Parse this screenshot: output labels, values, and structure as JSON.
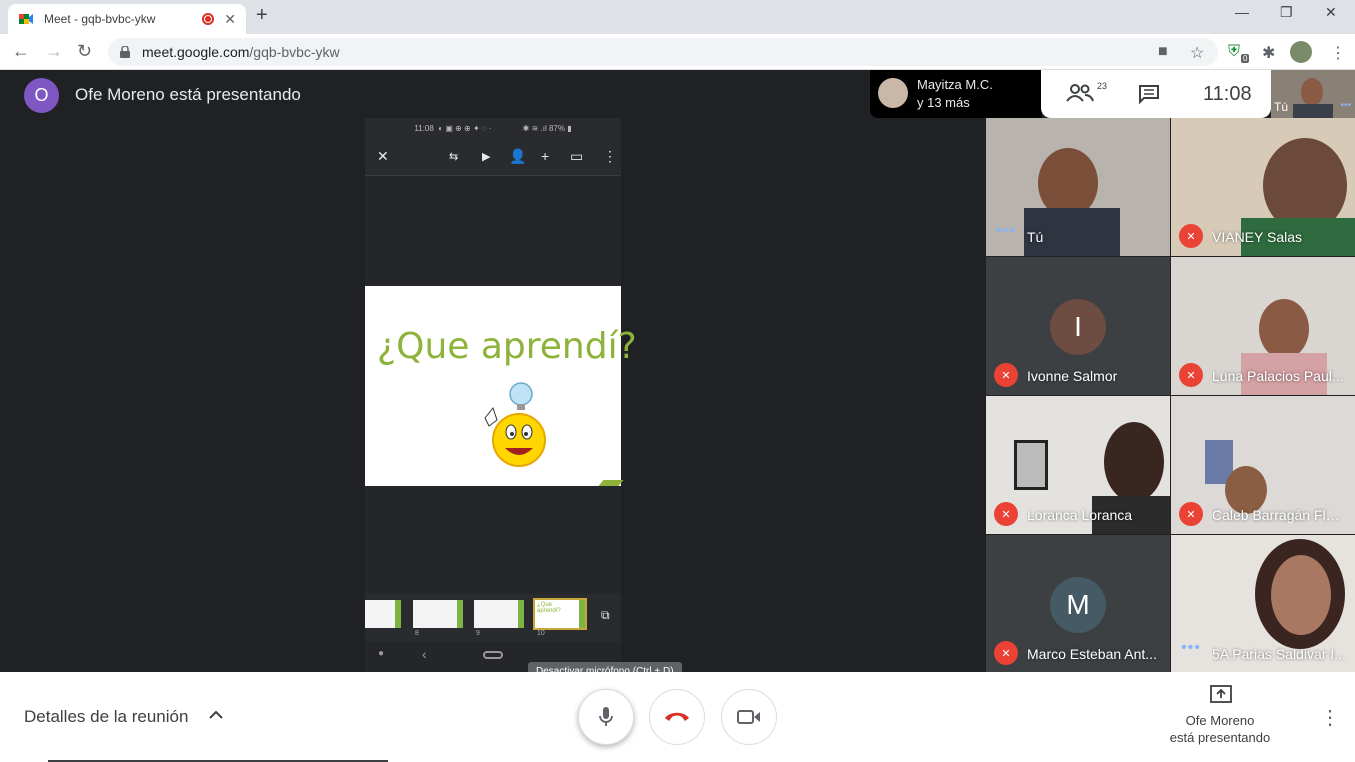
{
  "browser": {
    "tab_title": "Meet - gqb-bvbc-ykw",
    "url_host": "meet.google.com",
    "url_path": "/gqb-bvbc-ykw",
    "ext_badge": "0"
  },
  "meet": {
    "presenter_initial": "O",
    "presenter_title": "Ofe Moreno está presentando",
    "top_info": {
      "name": "Mayitza M.C.",
      "more": "y 13 más"
    },
    "people_count": "23",
    "clock": "11:08",
    "self_label": "Tú",
    "slide": {
      "status_time": "11:08",
      "status_battery": "87%",
      "title": "¿Que aprendí?",
      "thumb_numbers": [
        "8",
        "9",
        "10"
      ],
      "thumb_active_label": "¿Que aprendí?"
    },
    "tiles": [
      {
        "name": "Tú",
        "muted": false
      },
      {
        "name": "VIANEY Salas",
        "muted": true
      },
      {
        "name": "Ivonne Salmor",
        "muted": true,
        "initial": "I"
      },
      {
        "name": "Luna Palacios Paul...",
        "muted": true
      },
      {
        "name": "Loranca Loranca",
        "muted": true
      },
      {
        "name": "Caleb Barragán Flor...",
        "muted": true
      },
      {
        "name": "Marco Esteban Ant...",
        "muted": true,
        "initial": "M"
      },
      {
        "name": "5A Parias Saldivar I...",
        "muted": false
      }
    ]
  },
  "bottom": {
    "details_label": "Detalles de la reunión",
    "tooltip": "Desactivar micrófono (Ctrl + D)",
    "presenting_line1": "Ofe Moreno",
    "presenting_line2": "está presentando"
  },
  "colors": {
    "accent_red": "#ea4335",
    "slide_green": "#8db33a",
    "presenter_purple": "#7e57c2"
  }
}
